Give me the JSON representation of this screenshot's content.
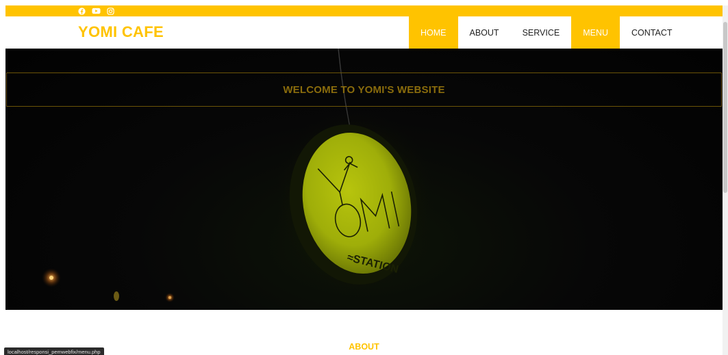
{
  "site": {
    "logo": "YOMI CAFE",
    "brand_color": "#ffc300"
  },
  "social": [
    {
      "icon": "facebook-icon"
    },
    {
      "icon": "youtube-icon"
    },
    {
      "icon": "instagram-icon"
    }
  ],
  "nav": {
    "items": [
      {
        "label": "HOME",
        "active": true
      },
      {
        "label": "ABOUT",
        "active": false
      },
      {
        "label": "SERVICE",
        "active": false
      },
      {
        "label": "MENU",
        "active": true
      },
      {
        "label": "CONTACT",
        "active": false
      }
    ]
  },
  "hero": {
    "welcome": "WELCOME TO YOMI'S WEBSITE",
    "sign_text": "YOMI",
    "sign_subtext": "STATION"
  },
  "about": {
    "heading": "ABOUT"
  },
  "status_bar": {
    "url": "localhost/responsi_pemwebfix/menu.php"
  }
}
